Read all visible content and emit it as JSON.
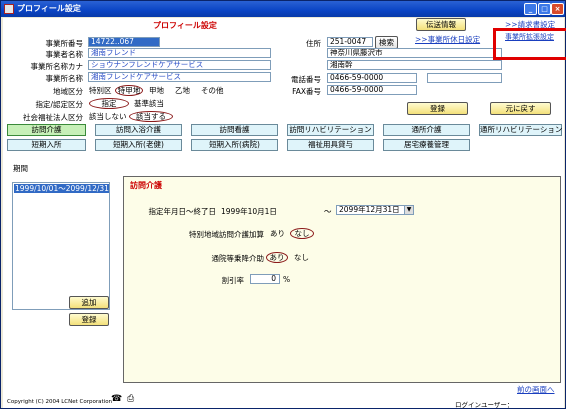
{
  "window": {
    "title": "プロフィール設定",
    "controls": [
      "_",
      "□",
      "×"
    ]
  },
  "header": {
    "section_title": "プロフィール設定"
  },
  "form": {
    "office_no": {
      "label": "事業所番号",
      "value": "14722..067"
    },
    "office_owner": {
      "label": "事業者名称",
      "value": "湘南フレンド"
    },
    "office_kana": {
      "label": "事業所名称カナ",
      "value": "ショウナンフレンドケアサービス"
    },
    "office_name": {
      "label": "事業所名称",
      "value": "湘南フレンドケアサービス"
    },
    "area": {
      "label": "地域区分",
      "options": [
        "特別区",
        "特甲地",
        "甲地",
        "乙地",
        "その他"
      ],
      "selected": "特甲地"
    },
    "designation": {
      "label": "指定/認定区分",
      "options": [
        "指定",
        "基準該当"
      ],
      "selected": "指定"
    },
    "welfare": {
      "label": "社会福祉法人区分",
      "options": [
        "該当しない",
        "該当する"
      ],
      "selected": "該当する"
    },
    "address": {
      "label": "住所",
      "postal": "251-0047",
      "search_button": "検索",
      "line1": "神奈川県藤沢市",
      "line2": "湘南幹"
    },
    "phone": {
      "label": "電話番号",
      "value": "0466-59-0000",
      "extra": ""
    },
    "fax": {
      "label": "FAX番号",
      "value": "0466-59-0000"
    }
  },
  "top_buttons": {
    "transmit": "伝送情報",
    "billing_link": ">>請求書設定",
    "holiday_link": ">>事業所休日設定",
    "extra_link": "事業所拡張設定"
  },
  "action_buttons": {
    "register": "登録",
    "back": "元に戻す"
  },
  "tabs_row1": [
    "訪問介護",
    "訪問入浴介護",
    "訪問看護",
    "訪問リハビリテーション",
    "通所介護",
    "通所リハビリテーション"
  ],
  "tabs_row2": [
    "短期入所",
    "短期入所(老健)",
    "短期入所(病院)",
    "福祉用具貸与",
    "居宅療養管理"
  ],
  "active_tab": "訪問介護",
  "period": {
    "label": "期間",
    "items": [
      "1999/10/01～2099/12/31"
    ],
    "add_button": "追加",
    "register_button": "登録"
  },
  "detail": {
    "title": "訪問介護",
    "date_label": "指定年月日～終了日",
    "start_date": "1999年10月1日",
    "tilde": "～",
    "end_date": "2099年12月31日",
    "special_area": {
      "label": "特別地域訪問介護加算",
      "options": [
        "あり",
        "なし"
      ],
      "selected": "なし"
    },
    "transport": {
      "label": "通院等乗降介助",
      "options": [
        "あり",
        "なし"
      ],
      "selected": "あり"
    },
    "discount": {
      "label": "割引率",
      "value": "0",
      "unit": "%"
    }
  },
  "footer": {
    "copyright": "Copyright (C) 2004 LCNet Corporation",
    "login_label": "ログインユーザー：",
    "prev_link": "前の画面へ"
  }
}
